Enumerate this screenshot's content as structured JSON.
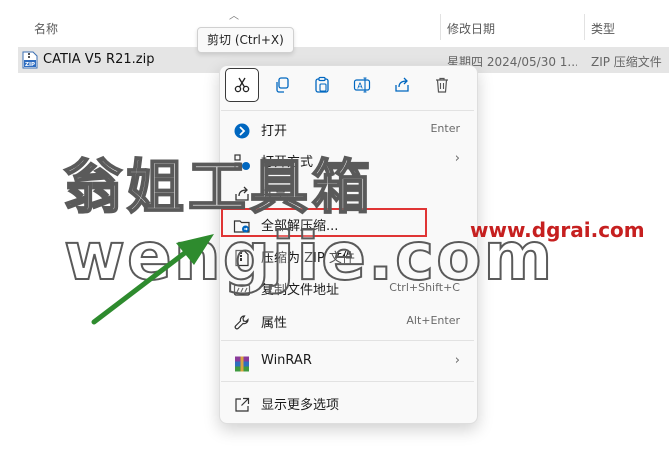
{
  "columns": {
    "name": "名称",
    "date": "修改日期",
    "type": "类型"
  },
  "file": {
    "name": "CATIA V5 R21.zip",
    "date": "星期四 2024/05/30 1...",
    "type": "ZIP 压缩文件"
  },
  "tooltip": "剪切 (Ctrl+X)",
  "quick_actions": [
    "cut-icon",
    "copy-icon",
    "paste-icon",
    "rename-icon",
    "share-icon",
    "delete-icon"
  ],
  "menu": {
    "open": {
      "label": "打开",
      "shortcut": "Enter"
    },
    "open_with": {
      "label": "打开方式"
    },
    "share": {
      "label": "共享"
    },
    "extract_all": {
      "label": "全部解压缩..."
    },
    "compress_zip": {
      "label": "压缩为 ZIP 文件"
    },
    "copy_path": {
      "label": "复制文件地址",
      "shortcut": "Ctrl+Shift+C"
    },
    "properties": {
      "label": "属性",
      "shortcut": "Alt+Enter"
    },
    "winrar": {
      "label": "WinRAR"
    },
    "more_options": {
      "label": "显示更多选项"
    }
  },
  "watermark": {
    "cn": "翁姐工具箱",
    "en": "wengjie.com",
    "site": "www.dgrai.com"
  },
  "colors": {
    "accent": "#0067c0",
    "highlight": "#e03535",
    "arrow": "#2e8b2e",
    "site": "#c62020"
  }
}
